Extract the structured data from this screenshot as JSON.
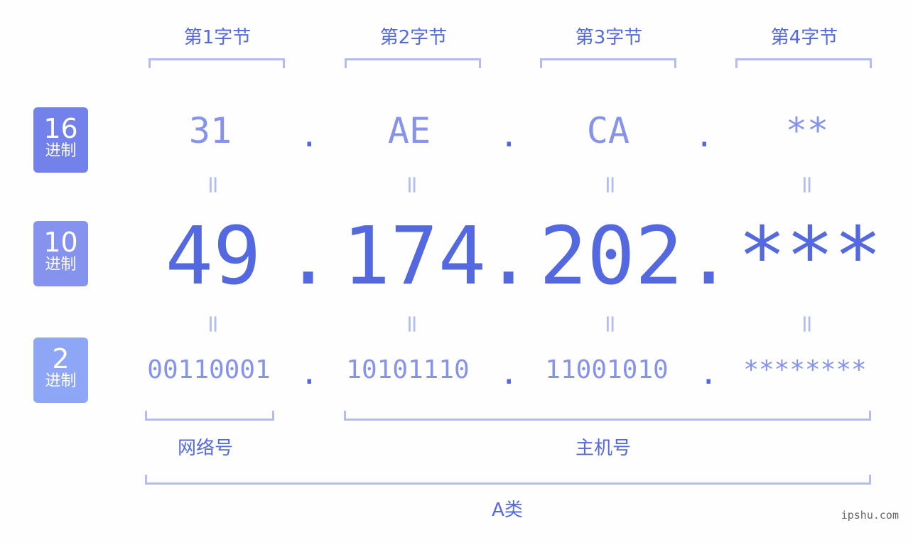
{
  "bytes": [
    {
      "label": "第1字节",
      "hex": "31",
      "dec": "49",
      "bin": "00110001"
    },
    {
      "label": "第2字节",
      "hex": "AE",
      "dec": "174",
      "bin": "10101110"
    },
    {
      "label": "第3字节",
      "hex": "CA",
      "dec": "202",
      "bin": "11001010"
    },
    {
      "label": "第4字节",
      "hex": "**",
      "dec": "***",
      "bin": "********"
    }
  ],
  "rows": [
    {
      "base": "16",
      "unit": "进制",
      "color": "#7381ea"
    },
    {
      "base": "10",
      "unit": "进制",
      "color": "#8593ee"
    },
    {
      "base": "2",
      "unit": "进制",
      "color": "#8ea6f6"
    }
  ],
  "separator": ".",
  "equals": "=",
  "network_label": "网络号",
  "host_label": "主机号",
  "class_label": "A类",
  "watermark": "ipshu.com",
  "colors": {
    "primary": "#5468e0",
    "light": "#8593ec",
    "bracket": "#b3bdf5"
  }
}
